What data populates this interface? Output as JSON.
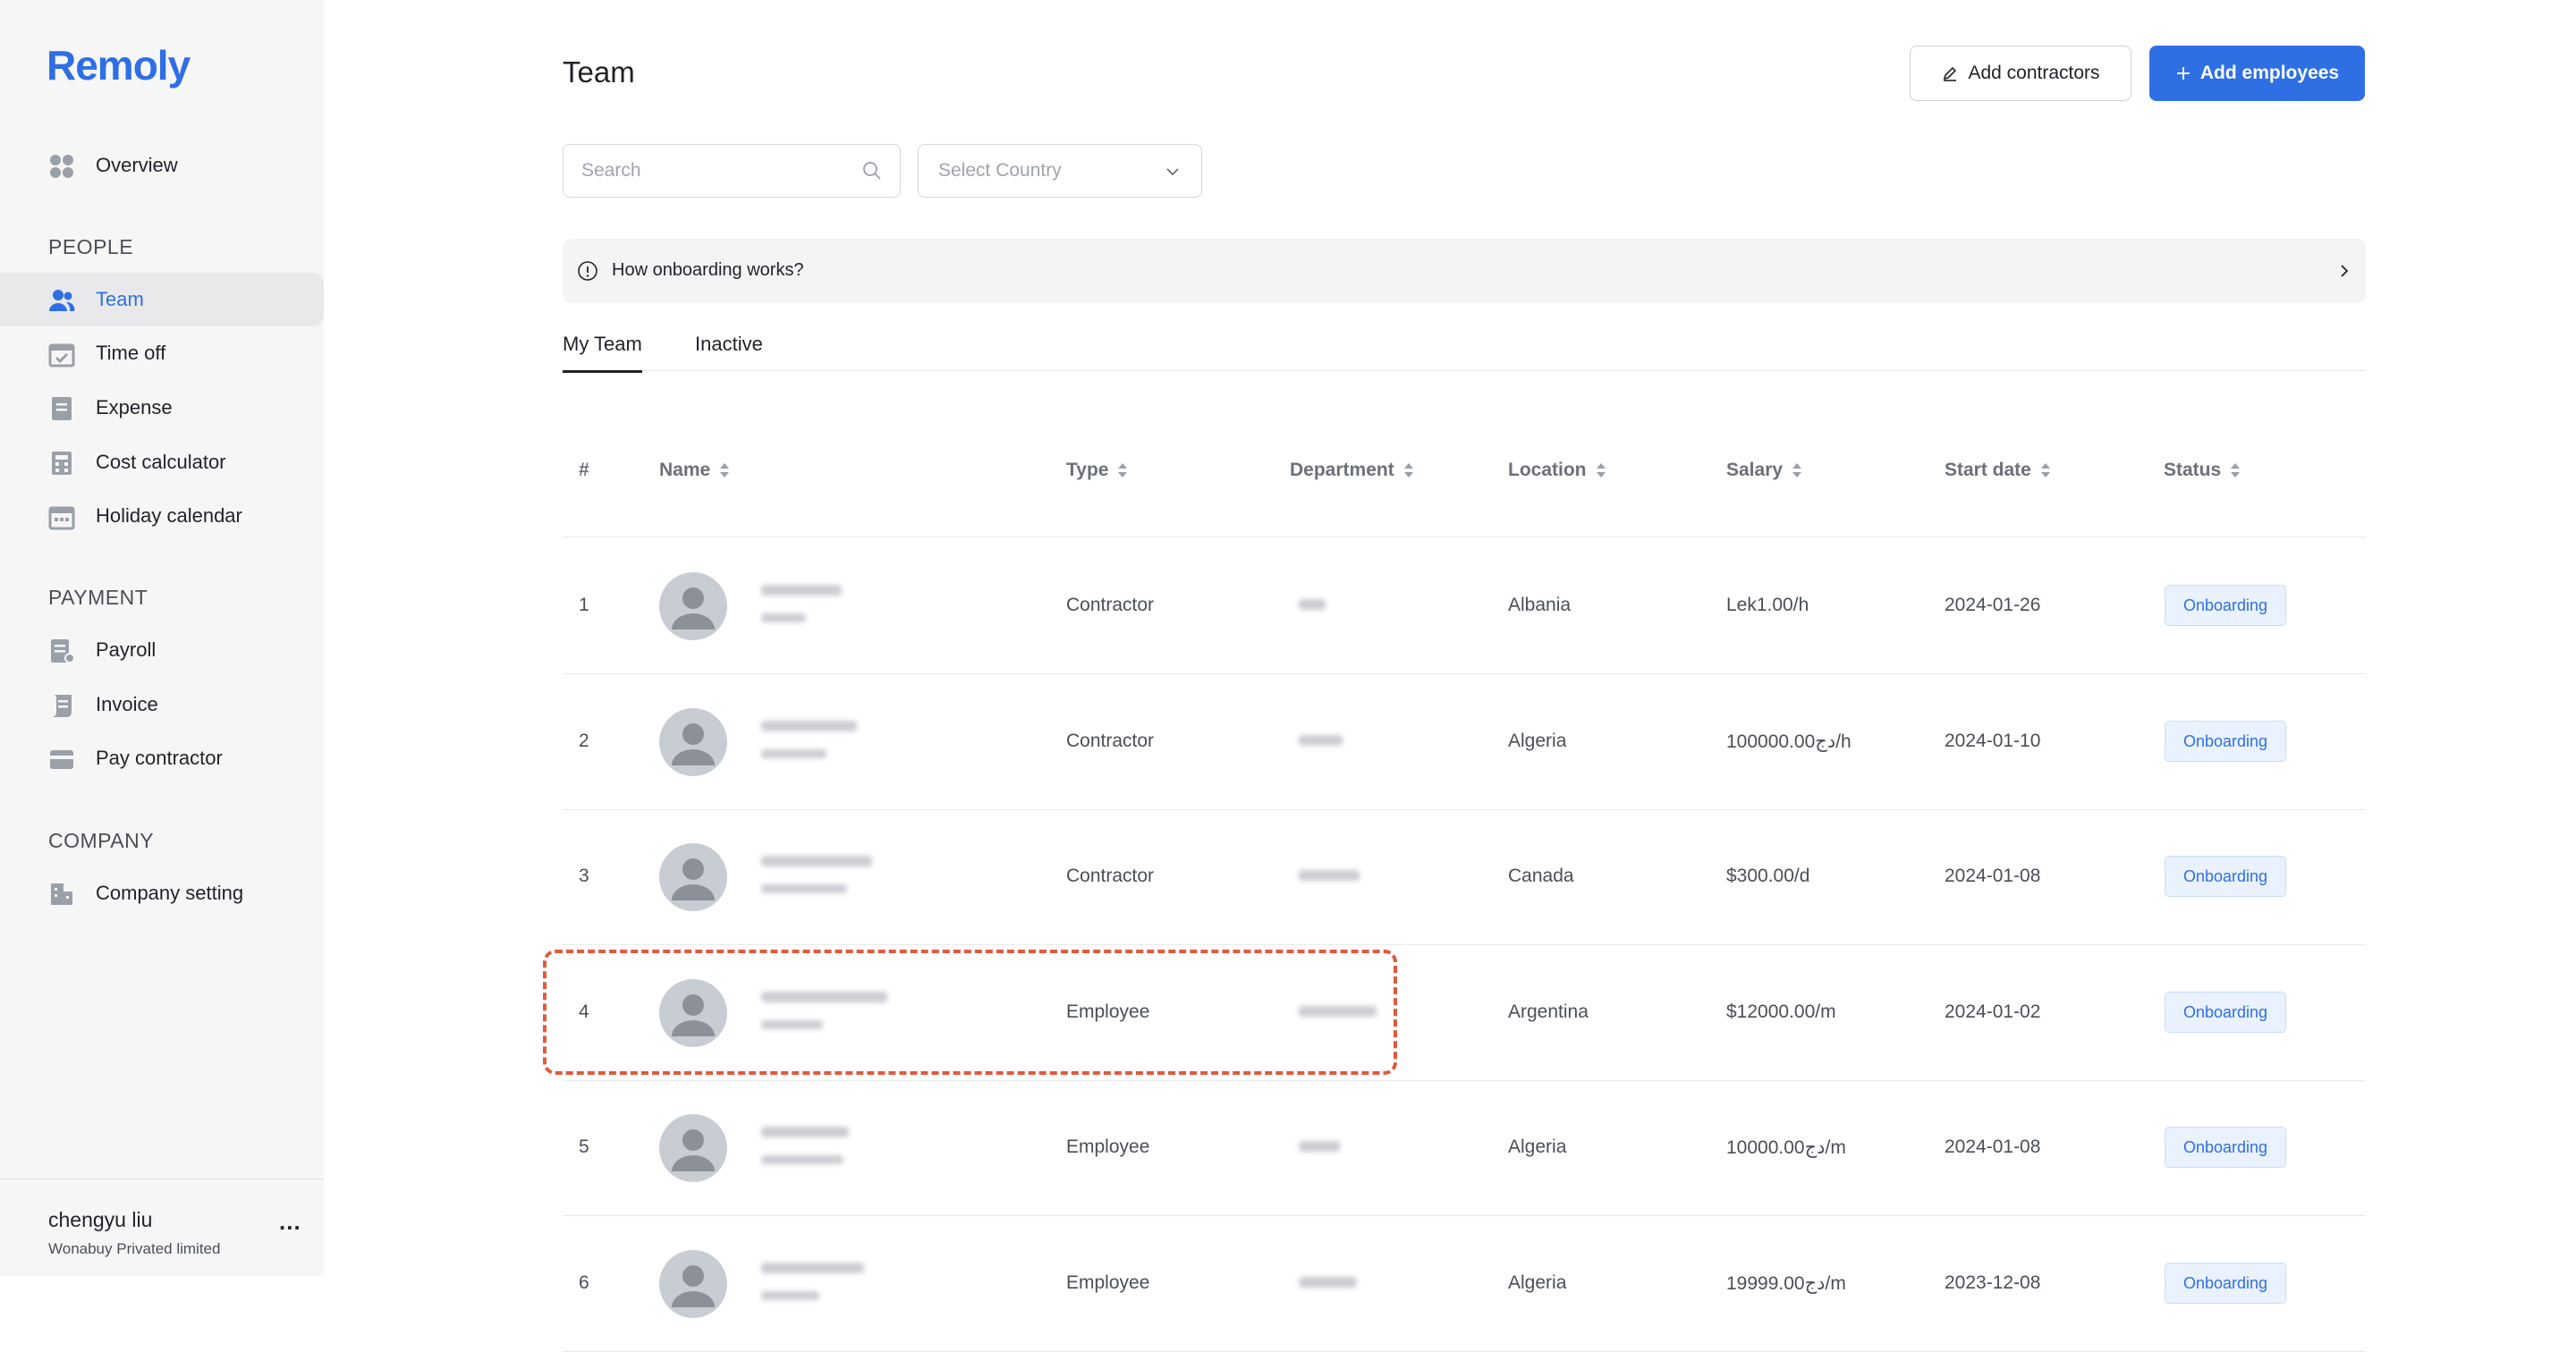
{
  "app": {
    "logo": "Remoly"
  },
  "sidebar": {
    "overview": "Overview",
    "sections": {
      "people": "PEOPLE",
      "payment": "PAYMENT",
      "company": "COMPANY"
    },
    "people_items": [
      "Team",
      "Time off",
      "Expense",
      "Cost calculator",
      "Holiday calendar"
    ],
    "payment_items": [
      "Payroll",
      "Invoice",
      "Pay contractor"
    ],
    "company_items": [
      "Company setting"
    ],
    "active_item": "Team",
    "user": {
      "name": "chengyu liu",
      "org": "Wonabuy Privated limited",
      "more": "..."
    }
  },
  "header": {
    "title": "Team",
    "add_contractors": "Add contractors",
    "add_employees": "Add employees"
  },
  "filters": {
    "search_placeholder": "Search",
    "country_placeholder": "Select Country"
  },
  "banner": {
    "text": "How onboarding works?"
  },
  "tabs": [
    "My Team",
    "Inactive"
  ],
  "active_tab": "My Team",
  "table": {
    "columns": [
      "#",
      "Name",
      "Type",
      "Department",
      "Location",
      "Salary",
      "Start date",
      "Status"
    ],
    "rows": [
      {
        "num": "1",
        "type": "Contractor",
        "location": "Albania",
        "salary": "Lek1.00/h",
        "start": "2024-01-26",
        "status": "Onboarding"
      },
      {
        "num": "2",
        "type": "Contractor",
        "location": "Algeria",
        "salary": "دج100000.00/h",
        "start": "2024-01-10",
        "status": "Onboarding"
      },
      {
        "num": "3",
        "type": "Contractor",
        "location": "Canada",
        "salary": "$300.00/d",
        "start": "2024-01-08",
        "status": "Onboarding"
      },
      {
        "num": "4",
        "type": "Employee",
        "location": "Argentina",
        "salary": "$12000.00/m",
        "start": "2024-01-02",
        "status": "Onboarding"
      },
      {
        "num": "5",
        "type": "Employee",
        "location": "Algeria",
        "salary": "دج10000.00/m",
        "start": "2024-01-08",
        "status": "Onboarding"
      },
      {
        "num": "6",
        "type": "Employee",
        "location": "Algeria",
        "salary": "دج19999.00/m",
        "start": "2023-12-08",
        "status": "Onboarding"
      }
    ]
  },
  "colors": {
    "accent": "#2f6fe4",
    "highlight": "#e05a3c",
    "sidebar_bg": "#f6f6f7"
  }
}
